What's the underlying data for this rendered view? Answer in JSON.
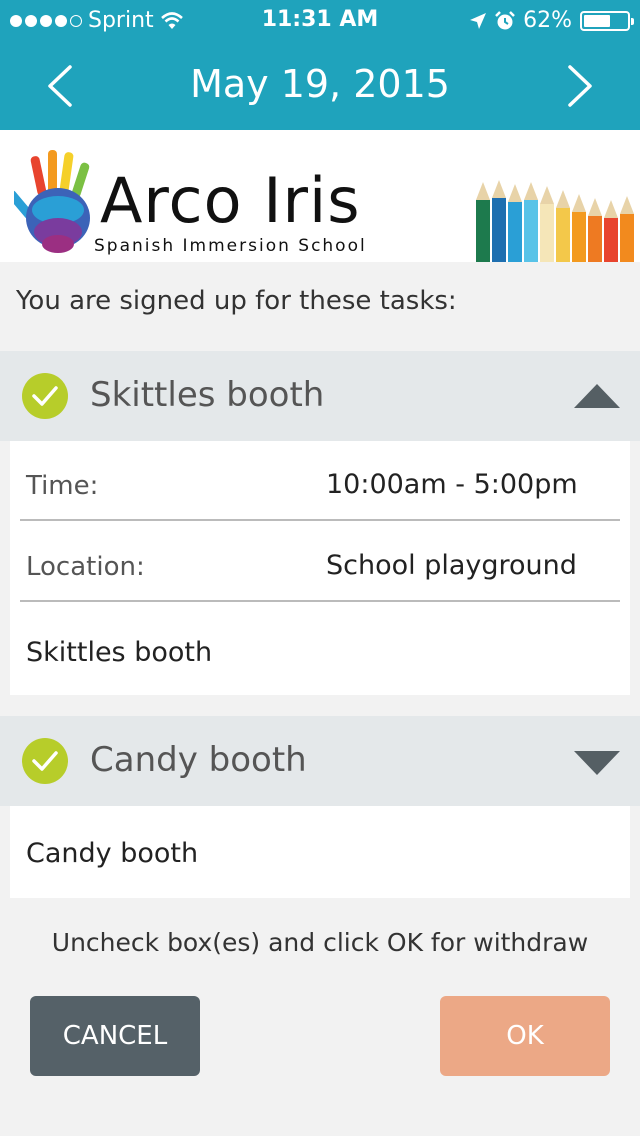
{
  "status_bar": {
    "carrier": "Sprint",
    "time": "11:31 AM",
    "battery_percent": "62%",
    "battery_level": 0.62,
    "signal_bars_filled": 4,
    "signal_bars_total": 5
  },
  "nav": {
    "title": "May 19, 2015",
    "prev_icon": "chevron-left-icon",
    "next_icon": "chevron-right-icon"
  },
  "banner": {
    "brand_name": "Arco Iris",
    "brand_subtitle": "Spanish Immersion School"
  },
  "intro_text": "You are signed up for these tasks:",
  "tasks": [
    {
      "title": "Skittles booth",
      "checked": true,
      "expanded": true,
      "details": [
        {
          "label": "Time:",
          "value": "10:00am - 5:00pm"
        },
        {
          "label": "Location:",
          "value": "School playground"
        }
      ],
      "description": "Skittles booth"
    },
    {
      "title": "Candy booth",
      "checked": true,
      "expanded": false,
      "description": "Candy booth"
    }
  ],
  "withdraw_note": "Uncheck box(es) and click OK for withdraw",
  "buttons": {
    "cancel": "CANCEL",
    "ok": "OK"
  },
  "colors": {
    "header": "#1fa3bc",
    "check": "#b7cd2a",
    "cancel_button": "#556168",
    "ok_button": "#eca886"
  }
}
